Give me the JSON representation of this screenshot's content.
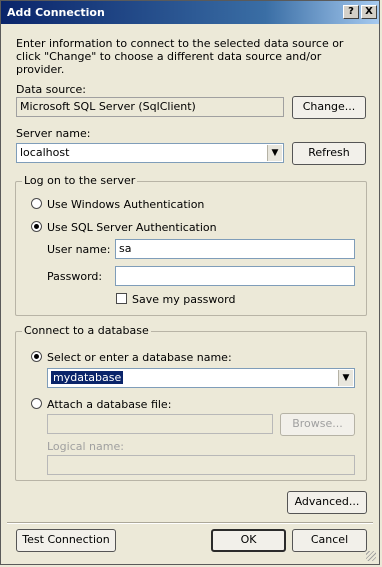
{
  "window": {
    "title": "Add Connection",
    "help_button": "?",
    "close_button": "X"
  },
  "intro_text": "Enter information to connect to the selected data source or click \"Change\" to choose a different data source and/or provider.",
  "data_source": {
    "label": "Data source:",
    "value": "Microsoft SQL Server (SqlClient)",
    "change_button": "Change..."
  },
  "server": {
    "label": "Server name:",
    "value": "localhost",
    "refresh_button": "Refresh"
  },
  "logon": {
    "group_label": "Log on to the server",
    "windows_auth_label": "Use Windows Authentication",
    "sql_auth_label": "Use SQL Server Authentication",
    "selected": "sql",
    "username_label": "User name:",
    "username_value": "sa",
    "password_label": "Password:",
    "password_value": "",
    "save_password_label": "Save my password",
    "save_password_checked": false
  },
  "database": {
    "group_label": "Connect to a database",
    "select_db_label": "Select or enter a database name:",
    "database_value": "mydatabase",
    "attach_file_label": "Attach a database file:",
    "attach_file_value": "",
    "browse_button": "Browse...",
    "logical_name_label": "Logical name:",
    "logical_name_value": "",
    "selected": "select"
  },
  "buttons": {
    "advanced": "Advanced...",
    "test_connection": "Test Connection",
    "ok": "OK",
    "cancel": "Cancel"
  }
}
